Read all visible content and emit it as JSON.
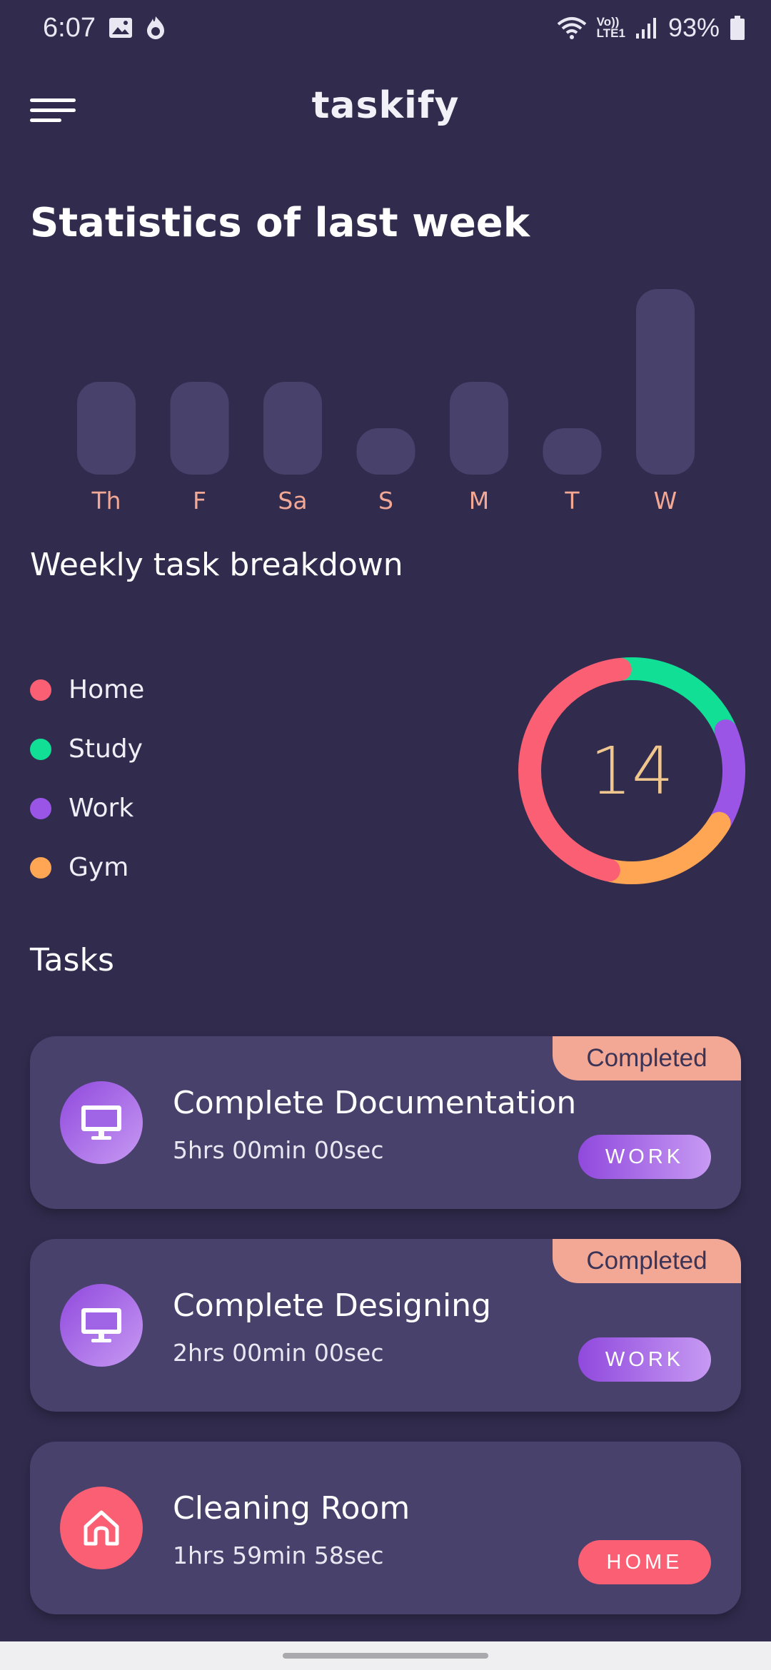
{
  "status_bar": {
    "time": "6:07",
    "battery": "93%",
    "network_top": "Vo))",
    "network_bottom": "LTE1",
    "icons": [
      "image-icon",
      "flame-icon",
      "wifi-icon",
      "signal-icon",
      "battery-icon"
    ]
  },
  "header": {
    "brand": "taskify",
    "menu_icon": "hamburger-menu-icon"
  },
  "stats": {
    "title": "Statistics of last week"
  },
  "chart_data": {
    "type": "bar",
    "categories": [
      "Th",
      "F",
      "Sa",
      "S",
      "M",
      "T",
      "W"
    ],
    "values": [
      2,
      2,
      2,
      1,
      2,
      1,
      4
    ],
    "ylim": [
      0,
      4
    ],
    "bar_color": "#47416b",
    "label_color": "#f2a895"
  },
  "breakdown": {
    "title": "Weekly task breakdown",
    "total": "14",
    "legend": [
      {
        "label": "Home",
        "color": "#fa5f73"
      },
      {
        "label": "Study",
        "color": "#10df95"
      },
      {
        "label": "Work",
        "color": "#9a55e6"
      },
      {
        "label": "Gym",
        "color": "#fea653"
      }
    ],
    "segments": [
      {
        "name": "Study",
        "color": "#10df95",
        "fraction": 0.2
      },
      {
        "name": "Work",
        "color": "#9a55e6",
        "fraction": 0.15
      },
      {
        "name": "Gym",
        "color": "#fea653",
        "fraction": 0.2
      },
      {
        "name": "Home",
        "color": "#fa5f73",
        "fraction": 0.45
      }
    ]
  },
  "tasks": {
    "title": "Tasks",
    "items": [
      {
        "title": "Complete Documentation",
        "time": "5hrs 00min 00sec",
        "tag": "WORK",
        "status": "Completed",
        "icon": "monitor-icon"
      },
      {
        "title": "Complete Designing",
        "time": "2hrs 00min 00sec",
        "tag": "WORK",
        "status": "Completed",
        "icon": "monitor-icon"
      },
      {
        "title": "Cleaning Room",
        "time": "1hrs 59min 58sec",
        "tag": "HOME",
        "status": "",
        "icon": "home-icon"
      }
    ]
  }
}
